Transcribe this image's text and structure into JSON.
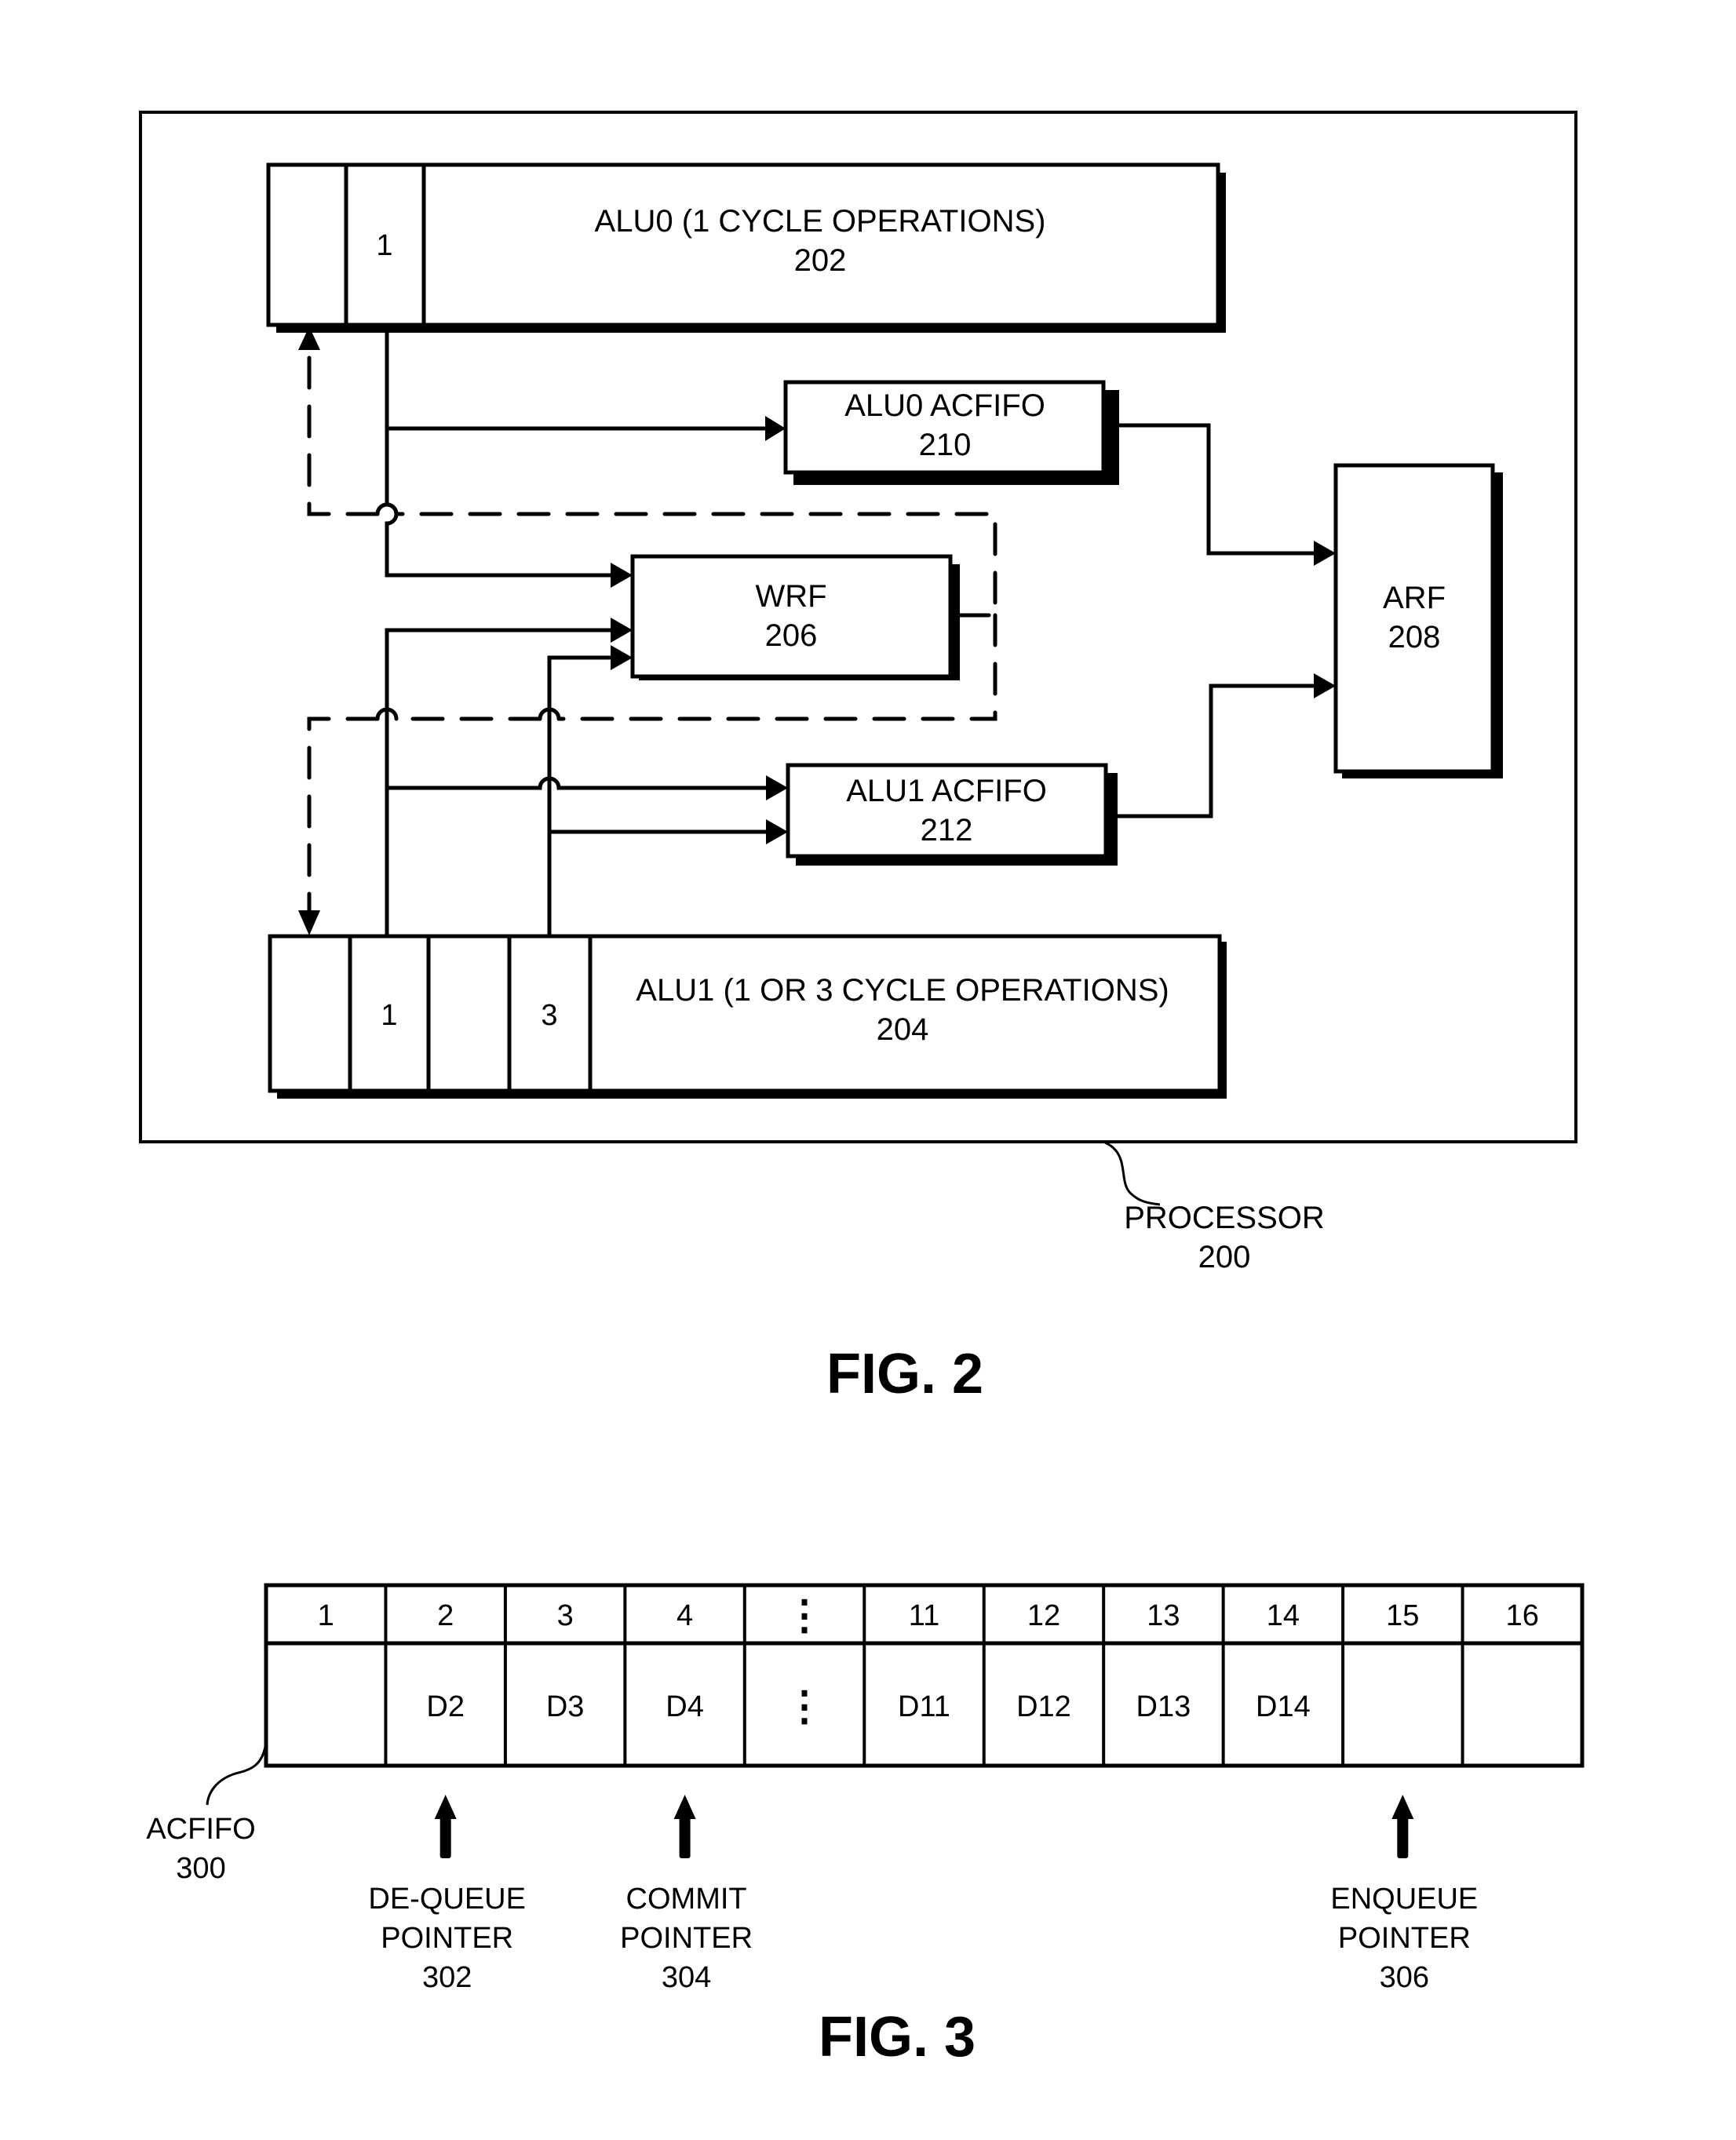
{
  "fig2": {
    "caption": "FIG. 2",
    "processor": {
      "name": "PROCESSOR",
      "ref": "200"
    },
    "alu0": {
      "name": "ALU0 (1 CYCLE OPERATIONS)",
      "ref": "202",
      "stages": [
        "",
        "1"
      ]
    },
    "alu1": {
      "name": "ALU1 (1 OR 3 CYCLE OPERATIONS)",
      "ref": "204",
      "stages": [
        "",
        "1",
        "",
        "3"
      ]
    },
    "wrf": {
      "name": "WRF",
      "ref": "206"
    },
    "arf": {
      "name": "ARF",
      "ref": "208"
    },
    "alu0_acfifo": {
      "name": "ALU0 ACFIFO",
      "ref": "210"
    },
    "alu1_acfifo": {
      "name": "ALU1 ACFIFO",
      "ref": "212"
    }
  },
  "fig3": {
    "caption": "FIG. 3",
    "acfifo": {
      "name": "ACFIFO",
      "ref": "300"
    },
    "slots": [
      {
        "index": "1",
        "data": ""
      },
      {
        "index": "2",
        "data": "D2"
      },
      {
        "index": "3",
        "data": "D3"
      },
      {
        "index": "4",
        "data": "D4"
      },
      {
        "index": "⋮",
        "data": "⋮"
      },
      {
        "index": "11",
        "data": "D11"
      },
      {
        "index": "12",
        "data": "D12"
      },
      {
        "index": "13",
        "data": "D13"
      },
      {
        "index": "14",
        "data": "D14"
      },
      {
        "index": "15",
        "data": ""
      },
      {
        "index": "16",
        "data": ""
      }
    ],
    "pointers": [
      {
        "line1": "DE-QUEUE",
        "line2": "POINTER",
        "ref": "302",
        "slot_index": 1
      },
      {
        "line1": "COMMIT",
        "line2": "POINTER",
        "ref": "304",
        "slot_index": 3
      },
      {
        "line1": "ENQUEUE",
        "line2": "POINTER",
        "ref": "306",
        "slot_index": 9
      }
    ]
  }
}
